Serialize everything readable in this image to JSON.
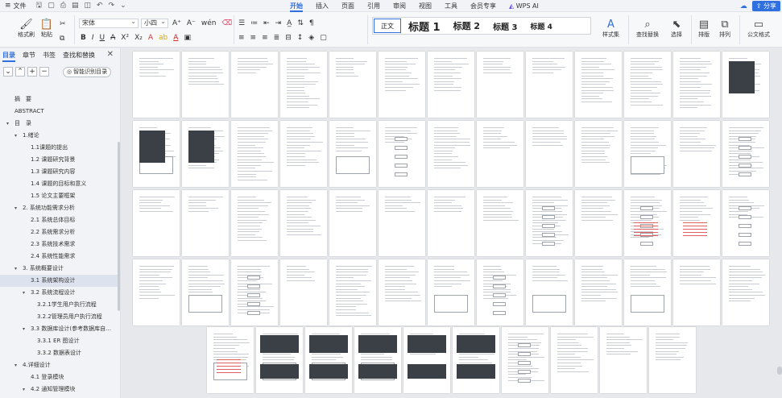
{
  "menubar": {
    "file_label": "文件",
    "tabs": [
      {
        "label": "开始",
        "active": true
      },
      {
        "label": "插入"
      },
      {
        "label": "页面"
      },
      {
        "label": "引用"
      },
      {
        "label": "审阅"
      },
      {
        "label": "视图"
      },
      {
        "label": "工具"
      },
      {
        "label": "会员专享"
      }
    ],
    "ai_label": "WPS AI",
    "share_label": "分享"
  },
  "ribbon": {
    "format_painter": "格式刷",
    "paste": "粘贴",
    "font_name": "宋体",
    "font_size": "小四",
    "styles": [
      "正文",
      "标题 1",
      "标题 2",
      "标题 3",
      "标题 4"
    ],
    "style_set": "样式集",
    "find_replace": "查找替换",
    "select": "选择",
    "sort": "排版",
    "arrange": "排列",
    "doc_format": "公文格式"
  },
  "nav": {
    "tabs": [
      "目录",
      "章节",
      "书签",
      "查找和替换"
    ],
    "smart_toc": "智能识别目录",
    "toc": [
      {
        "text": "摘　要",
        "level": 0,
        "arrow": false
      },
      {
        "text": "ABSTRACT",
        "level": 0,
        "arrow": false
      },
      {
        "text": "目　录",
        "level": 0,
        "arrow": true
      },
      {
        "text": "1.绪论",
        "level": 1,
        "arrow": true
      },
      {
        "text": "1.1课题的提出",
        "level": 2,
        "arrow": false
      },
      {
        "text": "1.2 课题研究背景",
        "level": 2,
        "arrow": false
      },
      {
        "text": "1.3 课题研究内容",
        "level": 2,
        "arrow": false
      },
      {
        "text": "1.4 课题的目标和意义",
        "level": 2,
        "arrow": false
      },
      {
        "text": "1.5 论文主要框架",
        "level": 2,
        "arrow": false
      },
      {
        "text": "2. 系统功能需求分析",
        "level": 1,
        "arrow": true
      },
      {
        "text": "2.1 系统总体目标",
        "level": 2,
        "arrow": false
      },
      {
        "text": "2.2 系统需求分析",
        "level": 2,
        "arrow": false
      },
      {
        "text": "2.3 系统技术需求",
        "level": 2,
        "arrow": false
      },
      {
        "text": "2.4 系统性能需求",
        "level": 2,
        "arrow": false
      },
      {
        "text": "3. 系统概要设计",
        "level": 1,
        "arrow": true
      },
      {
        "text": "3.1 系统架构设计",
        "level": 2,
        "arrow": false,
        "active": true
      },
      {
        "text": "3.2 系统流程设计",
        "level": 2,
        "arrow": true
      },
      {
        "text": "3.2.1学生用户执行流程",
        "level": 3,
        "arrow": false
      },
      {
        "text": "3.2.2管理员用户执行流程",
        "level": 3,
        "arrow": false
      },
      {
        "text": "3.3 数据库设计(参考数据库自…",
        "level": 2,
        "arrow": true
      },
      {
        "text": "3.3.1 ER 图设计",
        "level": 3,
        "arrow": false
      },
      {
        "text": "3.3.2 数据表设计",
        "level": 3,
        "arrow": false
      },
      {
        "text": "4.详细设计",
        "level": 1,
        "arrow": true
      },
      {
        "text": "4.1 登录模块",
        "level": 2,
        "arrow": false
      },
      {
        "text": "4.2 通知管理模块",
        "level": 2,
        "arrow": true
      }
    ]
  },
  "colors": {
    "accent": "#2f6fe0"
  }
}
